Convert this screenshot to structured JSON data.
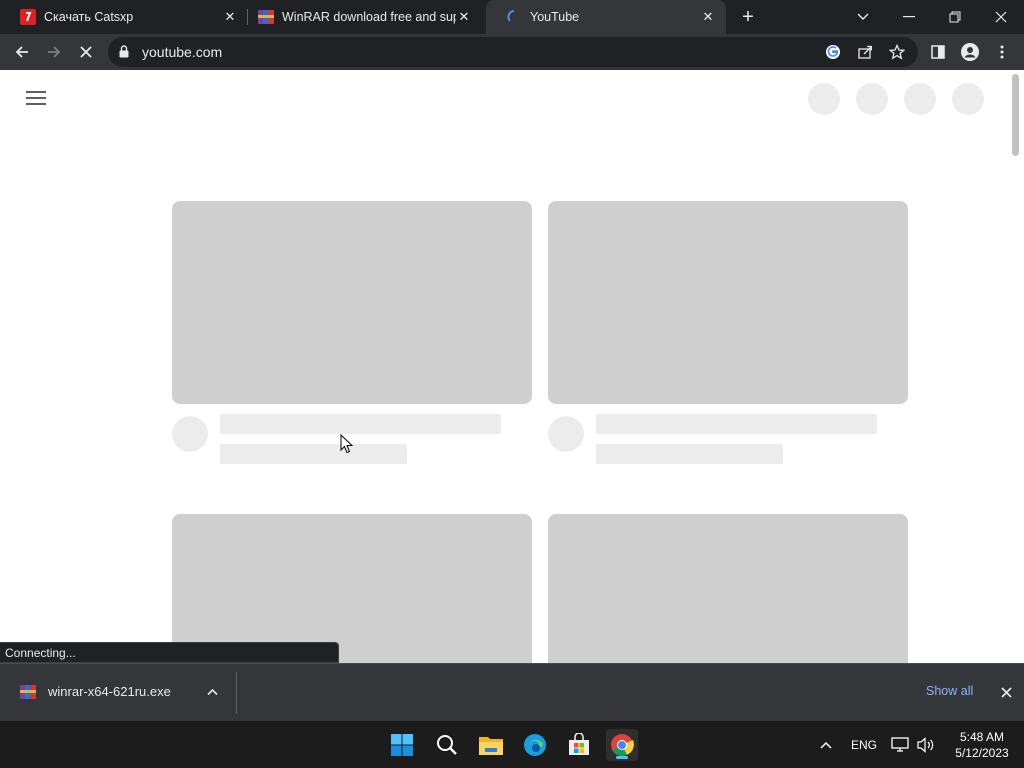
{
  "tabs": [
    {
      "title": "Скачать Catsxp",
      "icon": "catsxp-favicon"
    },
    {
      "title": "WinRAR download free and support",
      "icon": "winrar-favicon"
    },
    {
      "title": "YouTube",
      "icon": "loading-spinner-icon",
      "active": true
    }
  ],
  "toolbar": {
    "url": "youtube.com"
  },
  "page": {
    "status_text": "Connecting..."
  },
  "download_shelf": {
    "file_name": "winrar-x64-621ru.exe",
    "show_all_label": "Show all"
  },
  "taskbar": {
    "language": "ENG",
    "time": "5:48 AM",
    "date": "5/12/2023"
  },
  "colors": {
    "accent_link": "#8ab4f8",
    "skeleton_thumb": "#cfcfcf",
    "skeleton_light": "#ececec",
    "chrome_dark": "#202124",
    "chrome_toolbar": "#35363a"
  }
}
